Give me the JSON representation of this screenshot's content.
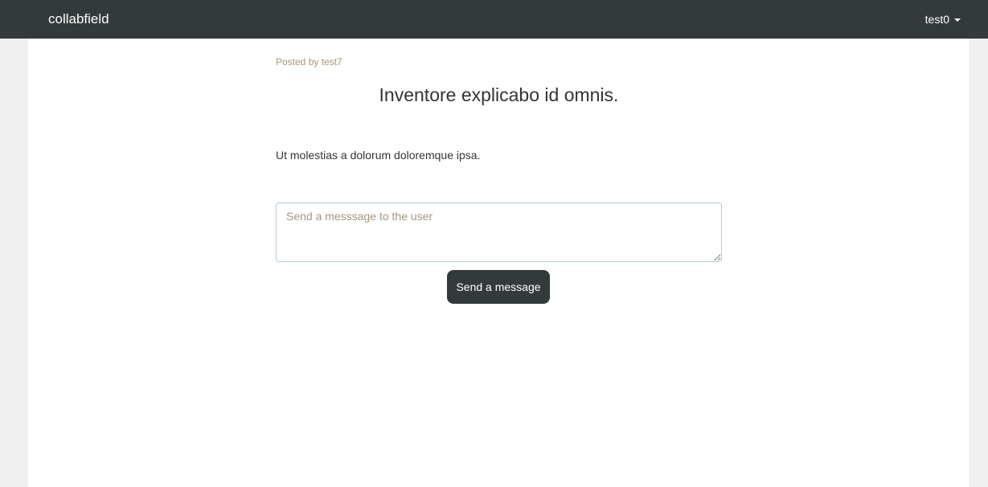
{
  "navbar": {
    "brand": "collabfield",
    "user": "test0"
  },
  "post": {
    "posted_by": "Posted by test7",
    "title": "Inventore explicabo id omnis.",
    "body": "Ut molestias a dolorum doloremque ipsa."
  },
  "message_form": {
    "placeholder": "Send a messsage to the user",
    "value": "",
    "submit_label": "Send a message"
  },
  "colors": {
    "navbar_bg": "#343a3b",
    "page_bg": "#f0f0f0",
    "content_bg": "#ffffff",
    "muted_text": "#a8957c",
    "button_bg": "#343a3b"
  },
  "icons": {
    "user_menu": "caret-down-icon"
  }
}
